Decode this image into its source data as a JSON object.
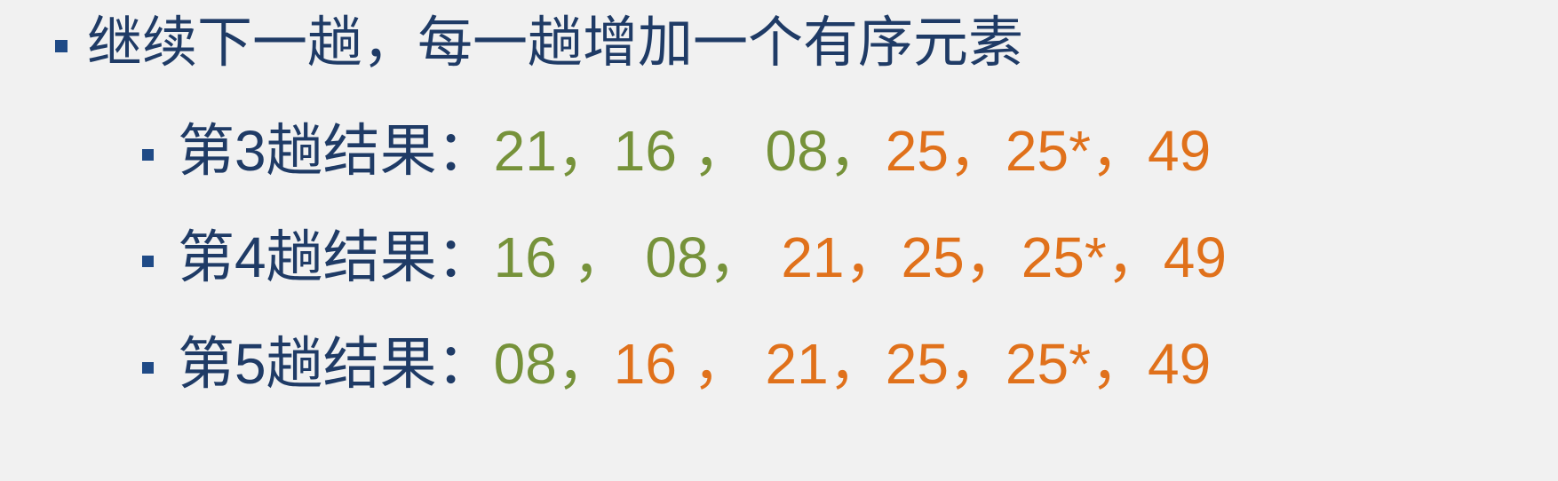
{
  "heading": "继续下一趟，每一趟增加一个有序元素",
  "colors": {
    "label": "#1f3b66",
    "unsorted": "#76923a",
    "sorted": "#e0711b",
    "bullet": "#1f4a86"
  },
  "rows": [
    {
      "label": "第3趟结果：",
      "tokens": [
        {
          "text": "21",
          "state": "unsorted"
        },
        {
          "text": "，",
          "state": "unsorted"
        },
        {
          "text": "16 ，",
          "state": "unsorted"
        },
        {
          "text": " 08",
          "state": "unsorted"
        },
        {
          "text": "，",
          "state": "unsorted"
        },
        {
          "text": "25",
          "state": "sorted"
        },
        {
          "text": "，",
          "state": "sorted"
        },
        {
          "text": "25*",
          "state": "sorted"
        },
        {
          "text": "，",
          "state": "sorted"
        },
        {
          "text": "49",
          "state": "sorted"
        }
      ]
    },
    {
      "label": "第4趟结果：",
      "tokens": [
        {
          "text": "16 ，",
          "state": "unsorted"
        },
        {
          "text": " 08",
          "state": "unsorted"
        },
        {
          "text": "，",
          "state": "unsorted"
        },
        {
          "text": " 21",
          "state": "sorted"
        },
        {
          "text": "，",
          "state": "sorted"
        },
        {
          "text": "25",
          "state": "sorted"
        },
        {
          "text": "，",
          "state": "sorted"
        },
        {
          "text": "25*",
          "state": "sorted"
        },
        {
          "text": "，",
          "state": "sorted"
        },
        {
          "text": "49",
          "state": "sorted"
        }
      ]
    },
    {
      "label": "第5趟结果：",
      "tokens": [
        {
          "text": "08",
          "state": "unsorted"
        },
        {
          "text": "，",
          "state": "unsorted"
        },
        {
          "text": "16 ，",
          "state": "sorted"
        },
        {
          "text": " 21",
          "state": "sorted"
        },
        {
          "text": "，",
          "state": "sorted"
        },
        {
          "text": "25",
          "state": "sorted"
        },
        {
          "text": "，",
          "state": "sorted"
        },
        {
          "text": "25*",
          "state": "sorted"
        },
        {
          "text": "，",
          "state": "sorted"
        },
        {
          "text": "49",
          "state": "sorted"
        }
      ]
    }
  ]
}
